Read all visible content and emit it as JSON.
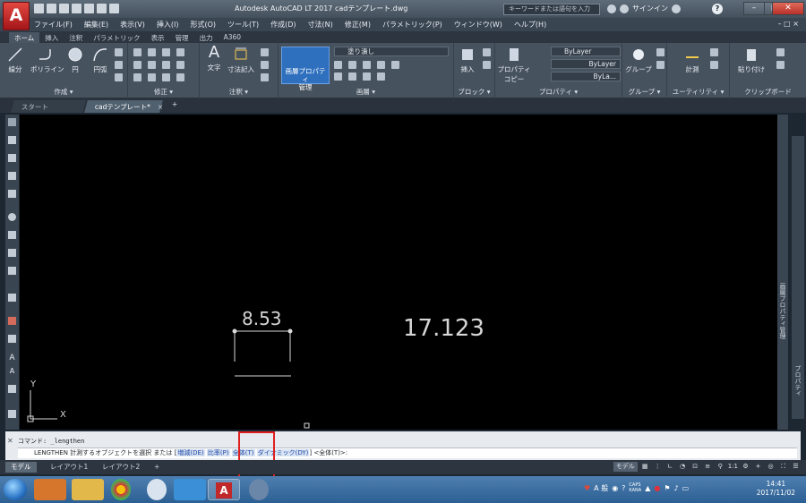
{
  "window": {
    "title": "Autodesk AutoCAD LT 2017     cadテンプレート.dwg",
    "search_placeholder": "キーワードまたは語句を入力",
    "signin": "サインイン",
    "help": "?",
    "app_letter": "A",
    "lt_label": "LT"
  },
  "menubar": {
    "items": [
      "ファイル(F)",
      "編集(E)",
      "表示(V)",
      "挿入(I)",
      "形式(O)",
      "ツール(T)",
      "作成(D)",
      "寸法(N)",
      "修正(M)",
      "パラメトリック(P)",
      "ウィンドウ(W)",
      "ヘルプ(H)"
    ]
  },
  "ribbon_tabs": [
    "ホーム",
    "挿入",
    "注釈",
    "パラメトリック",
    "表示",
    "管理",
    "出力",
    "A360"
  ],
  "ribbon": {
    "panels": {
      "draw": "作成 ▾",
      "modify": "修正 ▾",
      "annotation": "注釈 ▾",
      "layers": "画層 ▾",
      "block": "ブロック ▾",
      "properties": "プロパティ ▾",
      "groups": "グループ ▾",
      "utilities": "ユーティリティ ▾",
      "clipboard": "クリップボード"
    },
    "tools": {
      "line": "線分",
      "polyline": "ポリライン",
      "circle": "円",
      "arc": "円弧",
      "text": "文字",
      "dimension": "寸法記入",
      "layer_properties": "画層プロパティ\n管理",
      "insert": "挿入",
      "match_properties": "プロパティ\nコピー",
      "group": "グループ",
      "measure": "計測",
      "paste": "貼り付け"
    },
    "layer_dropdown": "塗り潰し",
    "bylayer_color": "ByLayer",
    "bylayer_linetype": "ByLayer",
    "bylayer_lineweight": "ByLa..."
  },
  "doc_tabs": {
    "start": "スタート",
    "active": "cadテンプレート*",
    "close": "×",
    "plus": "+"
  },
  "drawing": {
    "dim_small": "8.53",
    "dim_large": "17.123",
    "axis_y": "Y",
    "axis_x": "X"
  },
  "side_palette": {
    "label": "画層プロパティ管理",
    "label2": "プロパティ"
  },
  "command": {
    "history": "コマンド:  _lengthen",
    "prompt_cmd": "LENGTHEN 計測するオブジェクトを選択 または [",
    "opt_delta": "増減(DE)",
    "opt_percent": "比率(P)",
    "opt_total": "全体(T)",
    "opt_dynamic": "ダイナミック(DY)",
    "prompt_tail": "] <全体(T)>:"
  },
  "statusbar": {
    "model_tab": "モデル",
    "layout1": "レイアウト1",
    "layout2": "レイアウト2",
    "plus": "+",
    "model_label": "モデル",
    "scale": "1:1"
  },
  "taskbar": {
    "ime": "A 般",
    "caps": "CAPS\nKANA",
    "time": "14:41",
    "date": "2017/11/02"
  },
  "colors": {
    "canvas_bg": "#000000",
    "ribbon_bg": "#47525f",
    "accent": "#2e6fbe",
    "highlight_box": "#e02020"
  }
}
